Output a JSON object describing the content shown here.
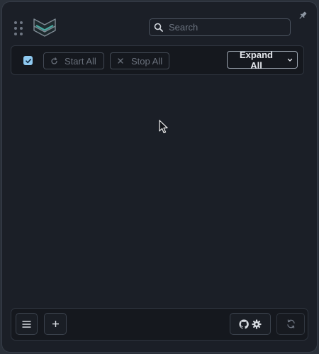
{
  "header": {
    "logo_icon": "chevron-shield-logo",
    "search": {
      "placeholder": "Search",
      "value": ""
    },
    "pin_icon": "pin-icon"
  },
  "toolbar": {
    "select_all_checked": true,
    "start_all_label": "Start All",
    "stop_all_label": "Stop All",
    "expand_all_label": "Expand All"
  },
  "footer": {
    "menu_icon": "menu-icon",
    "add_icon": "plus-icon",
    "github_icon": "github-icon",
    "settings_icon": "gear-icon",
    "refresh_icon": "refresh-icon"
  },
  "colors": {
    "background": "#1b1f27",
    "panel": "#15181e",
    "accent": "#8fc9f0",
    "text_primary": "#e6e9ee",
    "text_muted": "#6a717c"
  }
}
